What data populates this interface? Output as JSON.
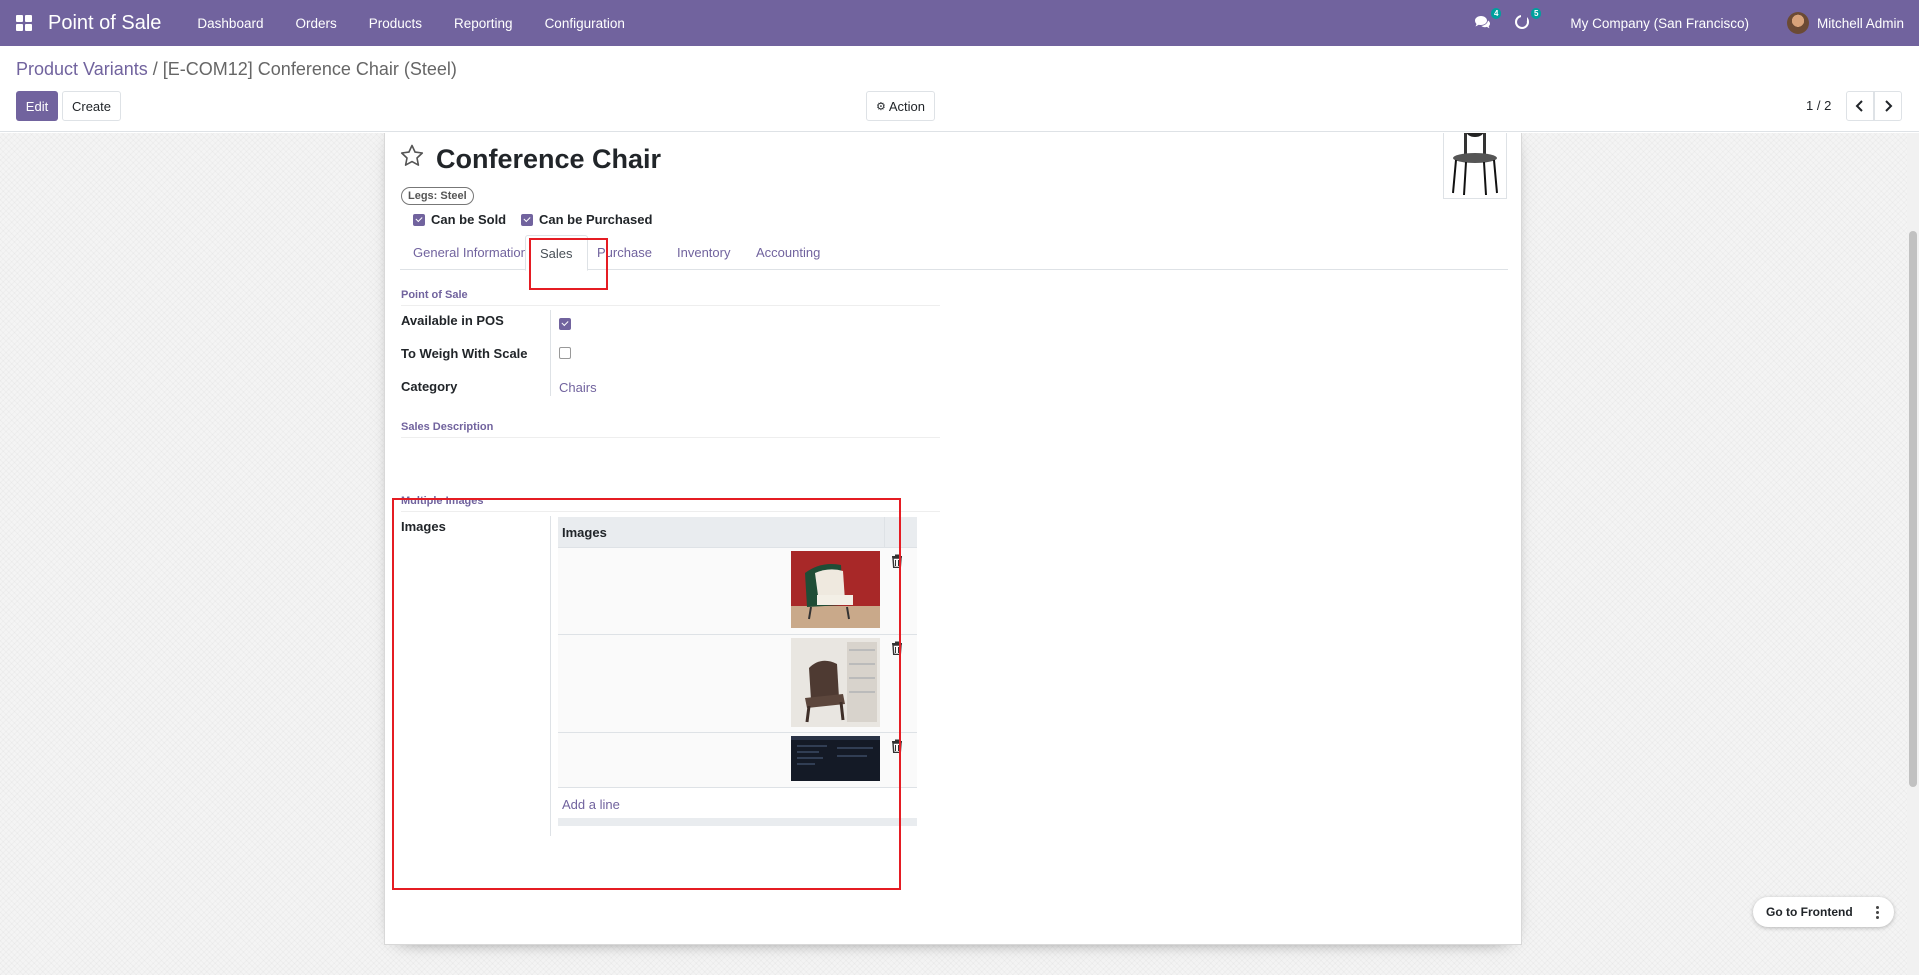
{
  "navbar": {
    "app_name": "Point of Sale",
    "menu": [
      "Dashboard",
      "Orders",
      "Products",
      "Reporting",
      "Configuration"
    ],
    "messages_count": "4",
    "activities_count": "5",
    "company": "My Company (San Francisco)",
    "user": "Mitchell Admin",
    "accent_color": "#71639e"
  },
  "control_panel": {
    "breadcrumb_parent": "Product Variants",
    "breadcrumb_sep": "/",
    "breadcrumb_current": "[E-COM12] Conference Chair (Steel)",
    "edit_label": "Edit",
    "create_label": "Create",
    "action_label": "Action",
    "pager": "1 / 2"
  },
  "form": {
    "product_name": "Conference Chair",
    "variant_tag": "Legs: Steel",
    "can_be_sold_label": "Can be Sold",
    "can_be_purchased_label": "Can be Purchased",
    "can_be_sold": true,
    "can_be_purchased": true,
    "tabs": [
      "General Information",
      "Sales",
      "Purchase",
      "Inventory",
      "Accounting"
    ],
    "active_tab": "Sales"
  },
  "pos_group": {
    "title": "Point of Sale",
    "available_in_pos_label": "Available in POS",
    "available_in_pos": true,
    "to_weigh_label": "To Weigh With Scale",
    "to_weigh": false,
    "category_label": "Category",
    "category_value": "Chairs"
  },
  "sales_description": {
    "title": "Sales Description"
  },
  "multiple_images": {
    "title": "Multiple Images",
    "images_label": "Images",
    "column_header": "Images",
    "rows": [
      {
        "image": "green-white-armchair"
      },
      {
        "image": "brown-plastic-chair"
      },
      {
        "image": "dark-screenshot"
      }
    ],
    "add_line_label": "Add a line"
  },
  "floating": {
    "go_to_frontend_label": "Go to Frontend"
  },
  "highlight_color": "#e51c23"
}
